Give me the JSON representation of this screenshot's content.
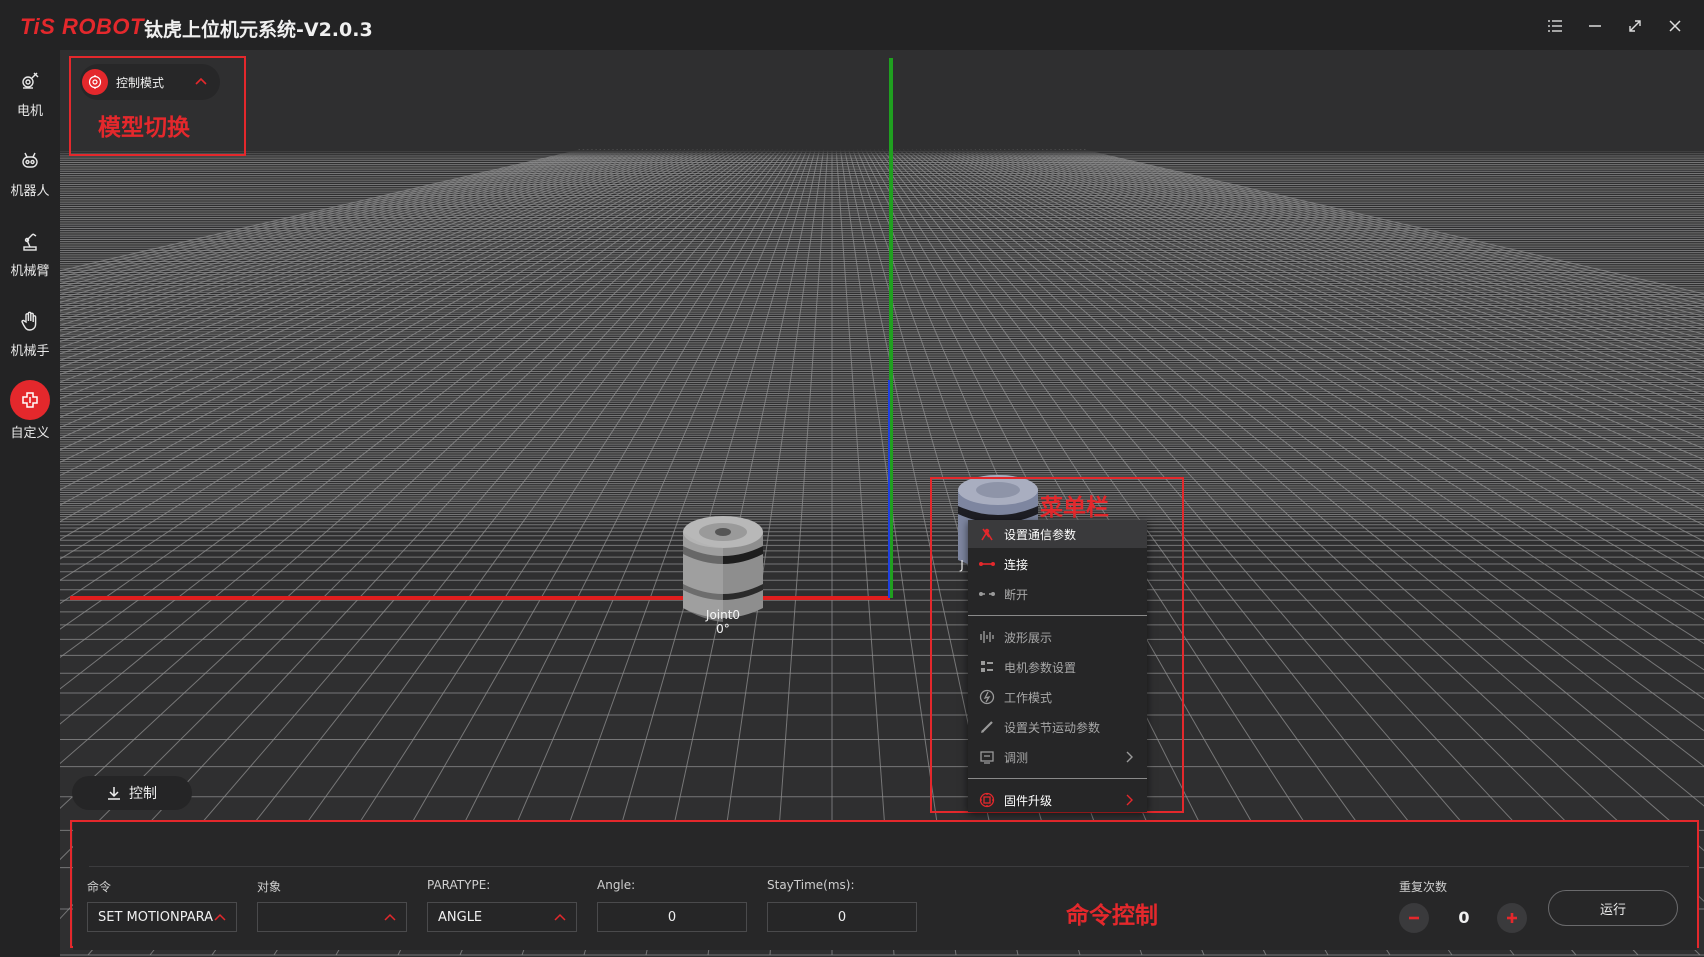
{
  "app": {
    "logo": "TiS ROBOT",
    "title": "钛虎上位机元系统-V2.0.3"
  },
  "window_controls": [
    "list-icon",
    "minimize-icon",
    "maximize-icon",
    "close-icon"
  ],
  "sidebar": {
    "items": [
      {
        "label": "电机",
        "icon": "motor-icon",
        "active": false
      },
      {
        "label": "机器人",
        "icon": "robot-icon",
        "active": false
      },
      {
        "label": "机械臂",
        "icon": "robot-arm-icon",
        "active": false
      },
      {
        "label": "机械手",
        "icon": "hand-icon",
        "active": false
      },
      {
        "label": "自定义",
        "icon": "custom-icon",
        "active": true
      }
    ]
  },
  "viewport": {
    "mode_selector": {
      "label": "控制模式"
    },
    "control_toggle": {
      "label": "控制"
    },
    "joints": [
      {
        "name": "Joint0",
        "angle": "0°"
      },
      {
        "name": "J",
        "angle": ""
      }
    ]
  },
  "annotations": {
    "model_switch": "模型切换",
    "menu_bar": "菜单栏",
    "command_control": "命令控制"
  },
  "context_menu": {
    "items": [
      {
        "label": "设置通信参数",
        "icon": "antenna-icon",
        "highlighted": true
      },
      {
        "label": "连接",
        "icon": "connect-icon"
      },
      {
        "label": "断开",
        "icon": "disconnect-icon"
      },
      {
        "label": "波形展示",
        "icon": "waveform-icon"
      },
      {
        "label": "电机参数设置",
        "icon": "parameters-icon"
      },
      {
        "label": "工作模式",
        "icon": "power-icon"
      },
      {
        "label": "设置关节运动参数",
        "icon": "edit-icon"
      },
      {
        "label": "调测",
        "icon": "debug-icon",
        "submenu": true
      },
      {
        "label": "固件升级",
        "icon": "chip-icon",
        "submenu": true
      }
    ]
  },
  "command_panel": {
    "command": {
      "label": "命令",
      "value": "SET MOTIONPARA"
    },
    "target": {
      "label": "对象",
      "value": ""
    },
    "paratype": {
      "label": "PARATYPE:",
      "value": "ANGLE"
    },
    "angle": {
      "label": "Angle:",
      "value": "0"
    },
    "staytime": {
      "label": "StayTime(ms):",
      "value": "0"
    },
    "repeat": {
      "label": "重复次数",
      "value": "0"
    },
    "run_label": "运行"
  },
  "colors": {
    "accent": "#e4282c",
    "background": "#232324",
    "viewport": "#2f2f30",
    "axis_x": "#e01e1e",
    "axis_y": "#1fa01f",
    "axis_z": "#2040e0"
  }
}
